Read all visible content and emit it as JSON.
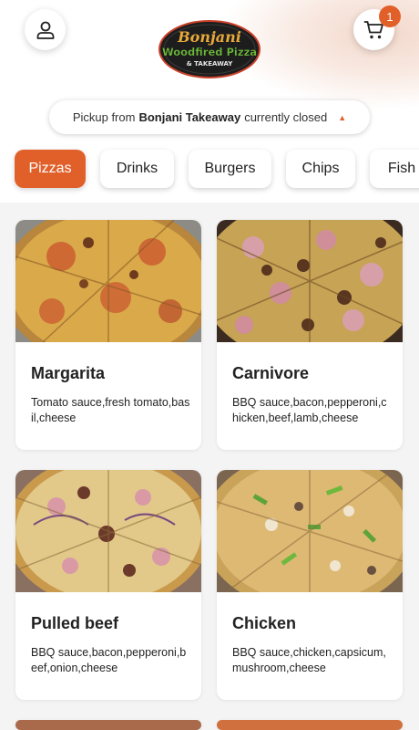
{
  "header": {
    "cart_count": "1",
    "logo": {
      "line1": "Bonjani",
      "line2": "Woodfired Pizza",
      "line3": "& TAKEAWAY"
    }
  },
  "pickup": {
    "prefix": "Pickup from",
    "store": "Bonjani Takeaway",
    "status": "currently closed"
  },
  "categories": [
    "Pizzas",
    "Drinks",
    "Burgers",
    "Chips",
    "Fish"
  ],
  "active_category": "Pizzas",
  "products": [
    {
      "name": "Margarita",
      "description": "Tomato sauce,fresh tomato,basil,cheese"
    },
    {
      "name": "Carnivore",
      "description": "BBQ sauce,bacon,pepperoni,chicken,beef,lamb,cheese"
    },
    {
      "name": "Pulled beef",
      "description": "BBQ sauce,bacon,pepperoni,beef,onion,cheese"
    },
    {
      "name": "Chicken",
      "description": "BBQ sauce,chicken,capsicum,mushroom,cheese"
    }
  ],
  "colors": {
    "accent": "#e1602a",
    "background": "#f4f4f4"
  }
}
